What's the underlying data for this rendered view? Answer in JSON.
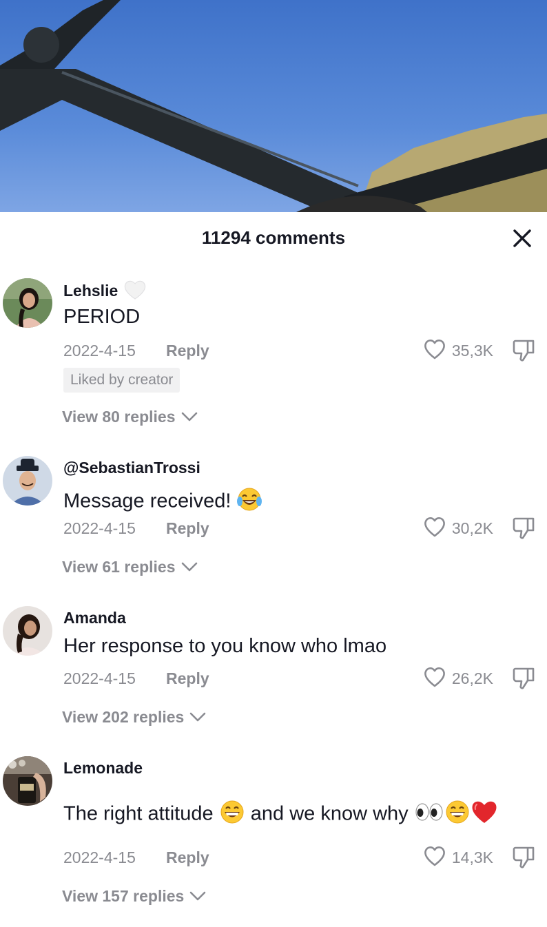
{
  "sheet": {
    "title": "11294 comments"
  },
  "comments": [
    {
      "username": "Lehslie",
      "text": "PERIOD",
      "date": "2022-4-15",
      "reply_label": "Reply",
      "likes": "35,3K",
      "liked_by_creator": "Liked by creator",
      "view_replies": "View 80 replies",
      "username_badge_icon": "white-heart-icon"
    },
    {
      "username": "@SebastianTrossi",
      "text": "Message received!",
      "text_emoji": "tears-of-joy-emoji",
      "date": "2022-4-15",
      "reply_label": "Reply",
      "likes": "30,2K",
      "view_replies": "View 61 replies"
    },
    {
      "username": "Amanda",
      "text": "Her response to you know who lmao",
      "date": "2022-4-15",
      "reply_label": "Reply",
      "likes": "26,2K",
      "view_replies": "View 202 replies"
    },
    {
      "username": "Lemonade",
      "text_part1": "The right attitude",
      "text_part2": "and we know why",
      "text_emojis": [
        "grinning-emoji",
        "eyes-emoji",
        "grinning-emoji",
        "red-heart-emoji"
      ],
      "date": "2022-4-15",
      "reply_label": "Reply",
      "likes": "14,3K",
      "view_replies": "View 157 replies"
    }
  ],
  "icons": {
    "close": "close-icon",
    "like": "heart-outline-icon",
    "dislike": "thumbs-down-icon",
    "chevron": "chevron-down-icon"
  },
  "colors": {
    "primary_text": "#161823",
    "secondary_text": "#8a8b91",
    "tag_bg": "#f1f1f2",
    "sky": "#4a7fd1"
  }
}
